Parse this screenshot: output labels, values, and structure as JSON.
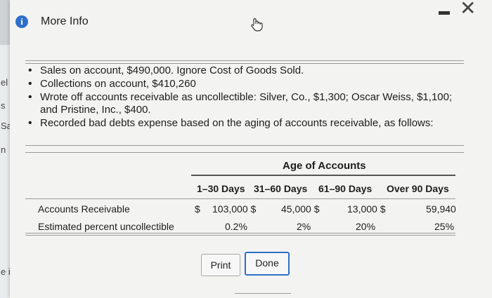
{
  "dialog": {
    "title": "More Info",
    "info_icon": "info-icon",
    "cursor_icon": "hand-cursor-icon"
  },
  "background_fragments": [
    "el",
    "s",
    "Sa",
    "n",
    "e inp"
  ],
  "bullets": [
    "Sales on account, $490,000. Ignore Cost of Goods Sold.",
    "Collections on account, $410,260",
    "Wrote off accounts receivable as uncollectible: Silver, Co., $1,300; Oscar Weiss, $1,100; and Pristine, Inc., $400.",
    "Recorded bad debts expense based on the aging of accounts receivable, as follows:"
  ],
  "table": {
    "group_header": "Age of Accounts",
    "columns": [
      "1–30 Days",
      "31–60 Days",
      "61–90 Days",
      "Over 90 Days"
    ],
    "rows": [
      {
        "label": "Accounts Receivable",
        "currency": "$",
        "values": [
          "103,000 $",
          "45,000 $",
          "13,000 $",
          "59,940"
        ]
      },
      {
        "label": "Estimated percent uncollectible",
        "values": [
          "0.2%",
          "2%",
          "20%",
          "25%"
        ]
      }
    ]
  },
  "buttons": {
    "print": "Print",
    "done": "Done"
  }
}
